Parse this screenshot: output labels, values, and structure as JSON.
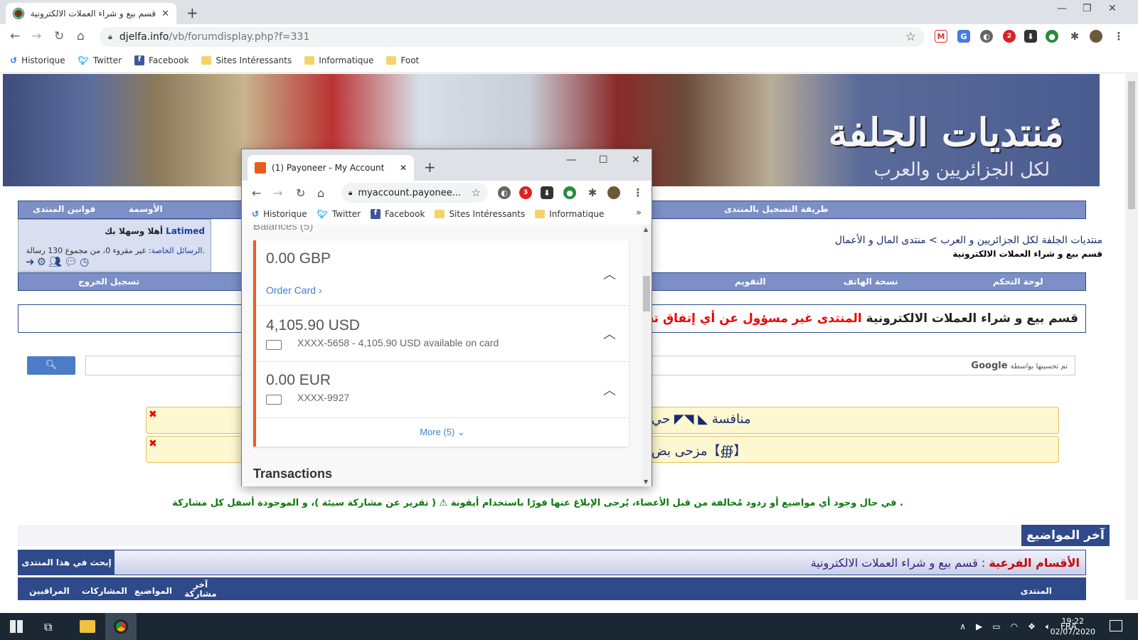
{
  "browser": {
    "tab_title": "قسم بيع و شراء العملات الالكترونية",
    "tab_close": "✕",
    "new_tab": "+",
    "url_host": "djelfa.info",
    "url_path": "/vb/forumdisplay.php?f=331",
    "bookmarks": [
      "Historique",
      "Twitter",
      "Facebook",
      "Sites Intéressants",
      "Informatique",
      "Foot"
    ],
    "ext_badge": "2"
  },
  "forum": {
    "logo_title": "مُنتديات الجلفة",
    "logo_subtitle": "لكل الجزائريين والعرب",
    "nav": {
      "rules": "قوانين المنتدى",
      "medals": "الأوسمة",
      "how_register": "طريقة التسجيل بالمنتدى"
    },
    "user": {
      "welcome_prefix": "أهلا وسهلا بك ",
      "username": "Latimed",
      "pm_label": "الرسائل الخاصة",
      "pm_info": ": غير مقروء 0، من مجموع 130 رسالة."
    },
    "breadcrumb": {
      "path": "منتديات الجلفة لكل الجزائريين و العرب > منتدى المال و الأعمال",
      "current": "قسم بيع و شراء العملات الالكترونية"
    },
    "bar2": {
      "control_panel": "لوحة التحكم",
      "mobile": "نسخة الهاتف",
      "calendar": "التقويم",
      "logout": "تسجيل الخروج"
    },
    "notice": {
      "section": "قسم بيع و شراء العملات الالكترونية",
      "warning": "المنتدى غير مسؤول عن أي إتفاق تجاري بين الأعضاء"
    },
    "search_note": "تم تحسينها بواسطة",
    "search_brand": "Google",
    "alerts": [
      "منافسة ◣ ◥◤ حي",
      "مزحى بض【∰】"
    ],
    "report_line": "في حال وجود أي مواضيع أو ردود مُخالفة من قبل الأعضاء، يُرجى الإبلاغ عنها فورًا باستخدام أيقونة ⚠ ( تقرير عن مشاركة سيئة )، و الموجودة أسفل كل مشاركة .",
    "latest_topics": "آخر المواضيع",
    "subsections_label": "الأقسام الفرعية",
    "subsections_value": " : قسم بيع و شراء العملات الالكترونية",
    "search_forum": "إبحث في هذا المنتدى ▾",
    "columns": [
      "المنتدى",
      "آخر مشاركة",
      "المواضيع",
      "المشاركات",
      "المراقبين"
    ]
  },
  "popup": {
    "tab_title": "(1) Payoneer - My Account",
    "url": "myaccount.payonee...",
    "ext_badge": "3",
    "bookmarks": [
      "Historique",
      "Twitter",
      "Facebook",
      "Sites Intéressants",
      "Informatique"
    ],
    "balances_label": "Balances (5)",
    "currencies": [
      {
        "amount": "0.00 GBP",
        "action": "Order Card ›"
      },
      {
        "amount": "4,105.90 USD",
        "card": "XXXX-5658 - 4,105.90 USD available on card"
      },
      {
        "amount": "0.00 EUR",
        "card": "XXXX-9927"
      }
    ],
    "more": "More (5) ⌄",
    "transactions": "Transactions"
  },
  "taskbar": {
    "lang": "FRA",
    "time": "19:22",
    "date": "02/07/2020"
  }
}
